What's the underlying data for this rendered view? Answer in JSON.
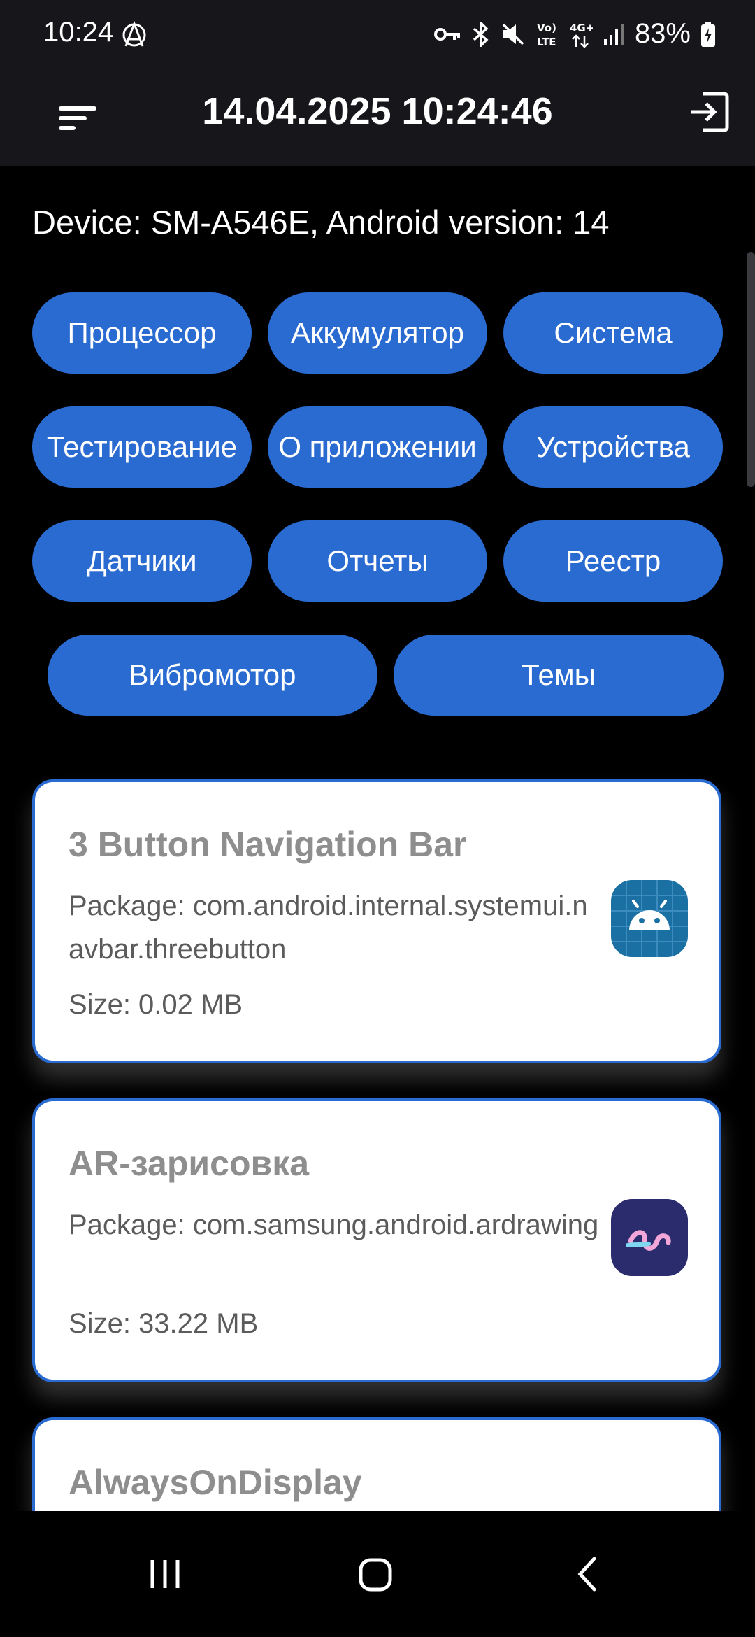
{
  "status_bar": {
    "time": "10:24",
    "battery": "83%",
    "icons": [
      "anarchy-icon",
      "vpn-key-icon",
      "bluetooth-icon",
      "mute-icon",
      "volte-icon",
      "4g-icon",
      "signal-icon",
      "battery-charging-icon"
    ]
  },
  "app_bar": {
    "title": "14.04.2025 10:24:46",
    "menu_icon": "sort-menu-icon",
    "exit_icon": "exit-icon"
  },
  "device_info": "Device: SM-A546E, Android version: 14",
  "chips": {
    "processor": "Процессор",
    "battery": "Аккумулятор",
    "system": "Система",
    "testing": "Тестирование",
    "about": "О приложении",
    "devices": "Устройства",
    "sensors": "Датчики",
    "reports": "Отчеты",
    "registry": "Реестр",
    "vibromotor": "Вибромотор",
    "themes": "Темы"
  },
  "apps": [
    {
      "name": "3 Button Navigation Bar",
      "package": "Package: com.android.internal.systemui.navbar.threebutton",
      "size": "Size: 0.02 MB",
      "icon": "android-robot-icon",
      "icon_color": "#1a6fa3"
    },
    {
      "name": "AR-зарисовка",
      "package": "Package: com.samsung.android.ardrawing",
      "size": "Size: 33.22 MB",
      "icon": "ar-drawing-icon",
      "icon_color": "#2b2c6e"
    },
    {
      "name": "AlwaysOnDisplay"
    }
  ],
  "colors": {
    "accent": "#2a6bd1",
    "background": "#000000",
    "app_bar": "#17161b"
  }
}
